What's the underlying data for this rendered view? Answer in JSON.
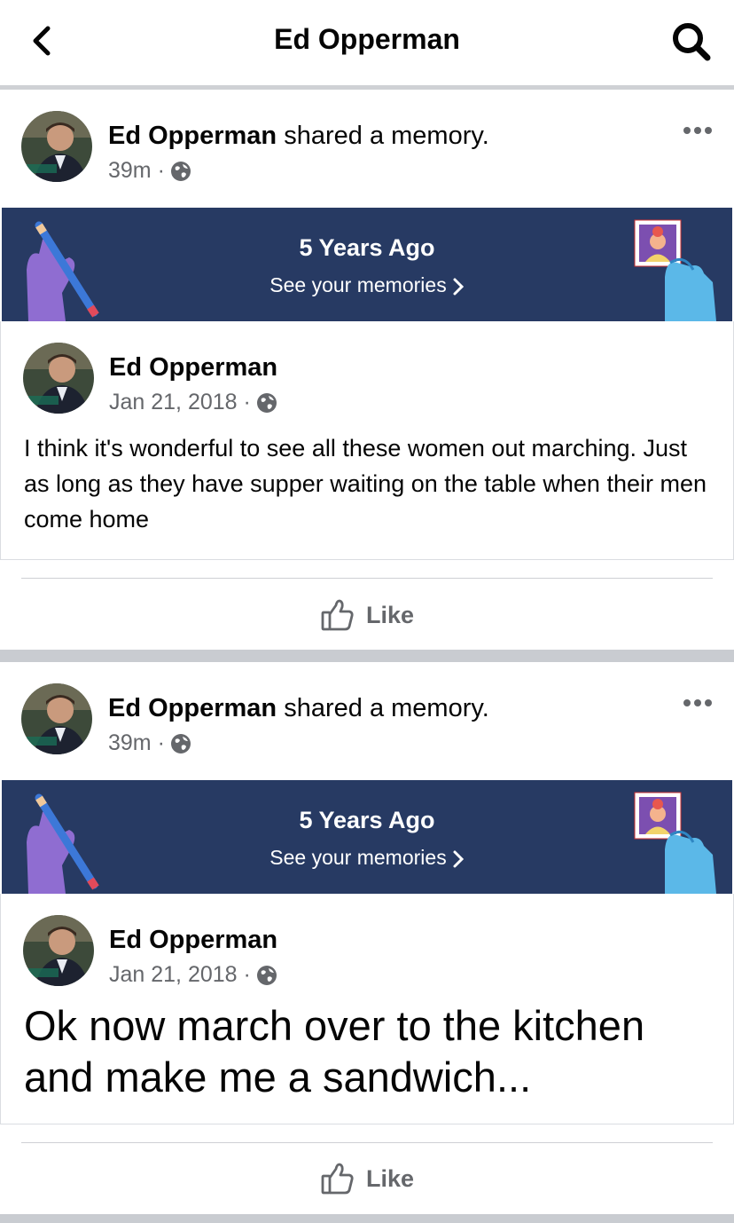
{
  "header": {
    "title": "Ed Opperman"
  },
  "posts": [
    {
      "author": "Ed Opperman",
      "action": " shared a memory.",
      "time": "39m ·",
      "banner_title": "5 Years Ago",
      "banner_link": "See your memories",
      "memory": {
        "author": "Ed Opperman",
        "date": "Jan 21, 2018 ·",
        "text": "I think it's wonderful to see all these women out marching. Just as long as they have supper waiting on the table when their men come home"
      },
      "like_label": "Like"
    },
    {
      "author": "Ed Opperman",
      "action": " shared a memory.",
      "time": "39m ·",
      "banner_title": "5 Years Ago",
      "banner_link": "See your memories",
      "memory": {
        "author": "Ed Opperman",
        "date": "Jan 21, 2018 ·",
        "text": "Ok now march over to the kitchen and make me a sandwich..."
      },
      "like_label": "Like"
    }
  ],
  "icons": {
    "back": "chevron-left-icon",
    "search": "search-icon",
    "more": "more-icon",
    "privacy": "globe-icon",
    "like": "thumbs-up-icon"
  },
  "colors": {
    "banner": "#273a63",
    "secondary_text": "#65676b",
    "divider": "#c9ccd1"
  }
}
